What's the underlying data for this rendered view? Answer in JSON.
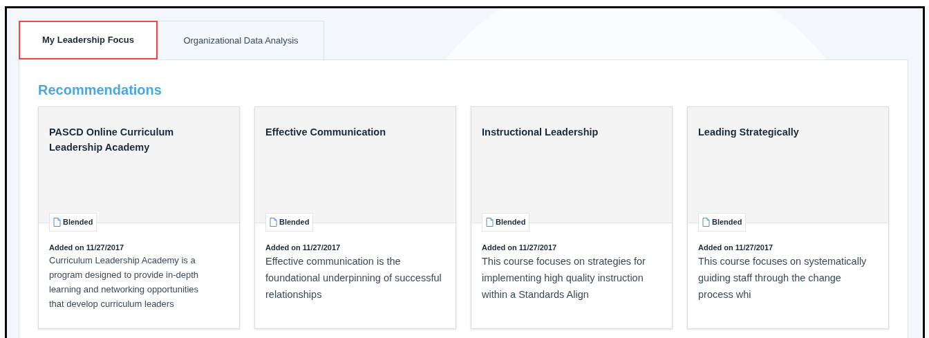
{
  "tabs": [
    {
      "label": "My Leadership Focus",
      "selected": true
    },
    {
      "label": "Organizational Data Analysis",
      "selected": false
    }
  ],
  "section_title": "Recommendations",
  "cards": [
    {
      "title": "PASCD Online Curriculum Leadership Academy",
      "badge": "Blended",
      "added": "Added on 11/27/2017",
      "description": "Curriculum Leadership Academy is a program designed to provide in-depth learning and networking opportunities that develop curriculum leaders"
    },
    {
      "title": "Effective Communication",
      "badge": "Blended",
      "added": "Added on 11/27/2017",
      "description": "Effective communication is the foundational underpinning of successful relationships"
    },
    {
      "title": "Instructional Leadership",
      "badge": "Blended",
      "added": "Added on 11/27/2017",
      "description": "This course focuses on strategies for implementing high quality instruction within a Standards Align"
    },
    {
      "title": "Leading Strategically",
      "badge": "Blended",
      "added": "Added on 11/27/2017",
      "description": "This course focuses on systematically guiding staff through the change process whi"
    }
  ]
}
